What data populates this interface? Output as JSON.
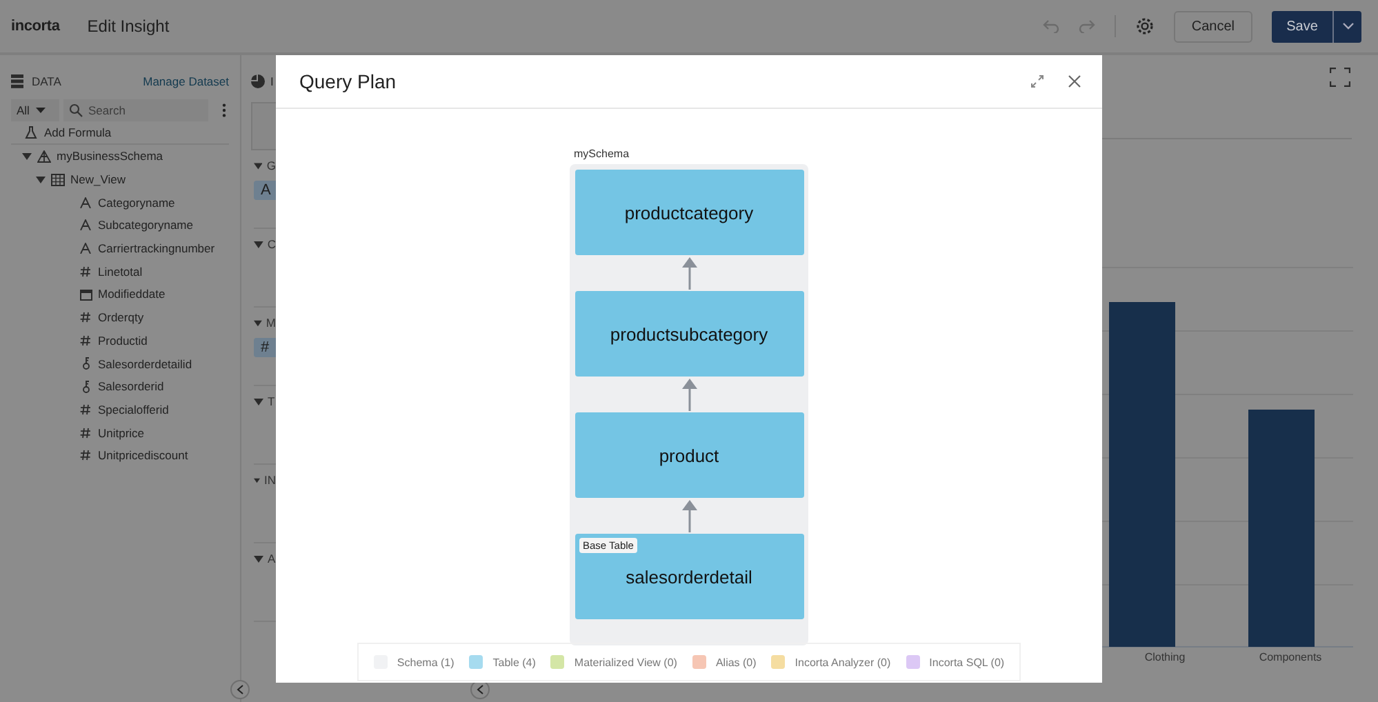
{
  "header": {
    "logo": "incorta",
    "title": "Edit Insight",
    "cancel": "Cancel",
    "save": "Save"
  },
  "data_panel": {
    "title": "DATA",
    "manage_link": "Manage Dataset",
    "filter": "All",
    "search": {
      "placeholder": "Search"
    },
    "add_formula": "Add Formula",
    "tree": [
      {
        "label": "myBusinessSchema",
        "kind": "schema",
        "expanded": true,
        "children": [
          {
            "label": "New_View",
            "kind": "view",
            "expanded": true,
            "children": [
              {
                "label": "Categoryname",
                "kind": "text"
              },
              {
                "label": "Subcategoryname",
                "kind": "text"
              },
              {
                "label": "Carriertrackingnumber",
                "kind": "text"
              },
              {
                "label": "Linetotal",
                "kind": "number"
              },
              {
                "label": "Modifieddate",
                "kind": "date"
              },
              {
                "label": "Orderqty",
                "kind": "number"
              },
              {
                "label": "Productid",
                "kind": "number"
              },
              {
                "label": "Salesorderdetailid",
                "kind": "key"
              },
              {
                "label": "Salesorderid",
                "kind": "key"
              },
              {
                "label": "Specialofferid",
                "kind": "number"
              },
              {
                "label": "Unitprice",
                "kind": "number"
              },
              {
                "label": "Unitpricediscount",
                "kind": "number"
              }
            ]
          }
        ]
      }
    ]
  },
  "middle_panel": {
    "title": "I",
    "sections": [
      {
        "title": "G",
        "chip": "A"
      },
      {
        "title": "C"
      },
      {
        "title": "M",
        "chip": "#"
      },
      {
        "title": "T"
      },
      {
        "title": "IN"
      },
      {
        "title": "A"
      }
    ]
  },
  "chart": {
    "categories": [
      "Clothing",
      "Components"
    ]
  },
  "dialog": {
    "title": "Query Plan",
    "group_label": "mySchema",
    "nodes": [
      {
        "label": "productcategory"
      },
      {
        "label": "productsubcategory"
      },
      {
        "label": "product"
      },
      {
        "label": "salesorderdetail",
        "badge": "Base Table"
      }
    ],
    "legend": [
      {
        "label": "Schema (1)",
        "color": "#f1f2f4"
      },
      {
        "label": "Table (4)",
        "color": "#a6dbef"
      },
      {
        "label": "Materialized View (0)",
        "color": "#d4e6a6"
      },
      {
        "label": "Alias (0)",
        "color": "#f6c6b4"
      },
      {
        "label": "Incorta Analyzer (0)",
        "color": "#f5dda1"
      },
      {
        "label": "Incorta SQL (0)",
        "color": "#dcc8f5"
      }
    ]
  }
}
